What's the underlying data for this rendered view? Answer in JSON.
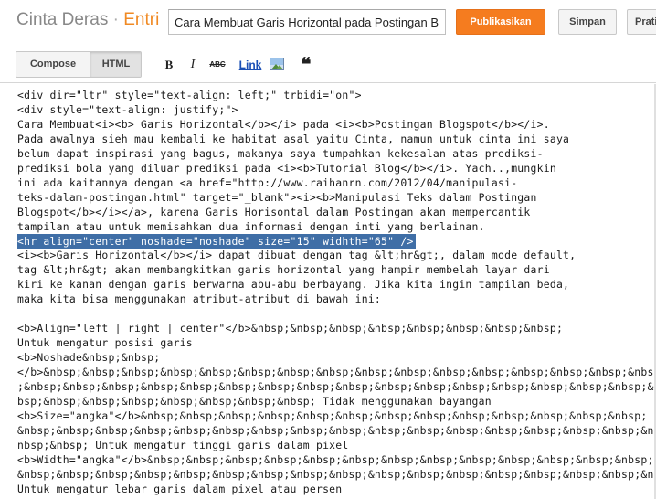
{
  "header": {
    "blog_name": "Cinta Deras",
    "separator": "·",
    "section": "Entri",
    "post_title": "Cara Membuat Garis Horizontal pada Postingan Blogspot",
    "publish_label": "Publikasikan",
    "save_label": "Simpan",
    "preview_label": "Pratinjau"
  },
  "toolbar": {
    "compose_label": "Compose",
    "html_label": "HTML",
    "bold_label": "B",
    "italic_label": "I",
    "strike_label": "ABC",
    "link_label": "Link",
    "image_icon": "insert-image-icon",
    "quote_label": "❝"
  },
  "colors": {
    "accent": "#f08a24",
    "publish_bg": "#f57c1f",
    "selection": "#3f6ea6",
    "link": "#1a4fb5"
  },
  "editor": {
    "lines": [
      "<div dir=\"ltr\" style=\"text-align: left;\" trbidi=\"on\">",
      "<div style=\"text-align: justify;\">",
      "Cara Membuat<i><b> Garis Horizontal</b></i> pada <i><b>Postingan Blogspot</b></i>.",
      "Pada awalnya sieh mau kembali ke habitat asal yaitu Cinta, namun untuk cinta ini saya",
      "belum dapat inspirasi yang bagus, makanya saya tumpahkan kekesalan atas prediksi-",
      "prediksi bola yang diluar prediksi pada <i><b>Tutorial Blog</b></i>. Yach..,mungkin",
      "ini ada kaitannya dengan <a href=\"http://www.raihanrn.com/2012/04/manipulasi-",
      "teks-dalam-postingan.html\" target=\"_blank\"><i><b>Manipulasi Teks dalam Postingan",
      "Blogspot</b></i></a>, karena Garis Horisontal dalam Postingan akan mempercantik",
      "tampilan atau untuk memisahkan dua informasi dengan inti yang berlainan.",
      "<hr align=\"center\" noshade=\"noshade\" size=\"15\" widhth=\"65\" />",
      "<i><b>Garis Horizontal</b></i> dapat dibuat dengan tag &lt;hr&gt;, dalam mode default,",
      "tag &lt;hr&gt; akan membangkitkan garis horizontal yang hampir membelah layar dari",
      "kiri ke kanan dengan garis berwarna abu-abu berbayang. Jika kita ingin tampilan beda,",
      "maka kita bisa menggunakan atribut-atribut di bawah ini:",
      "",
      "<b>Align=\"left | right | center\"</b>&nbsp;&nbsp;&nbsp;&nbsp;&nbsp;&nbsp;&nbsp;&nbsp;",
      "Untuk mengatur posisi garis",
      "<b>Noshade&nbsp;&nbsp;",
      "</b>&nbsp;&nbsp;&nbsp;&nbsp;&nbsp;&nbsp;&nbsp;&nbsp;&nbsp;&nbsp;&nbsp;&nbsp;&nbsp;&nbsp;&nbsp;&nbsp;&nbsp",
      ";&nbsp;&nbsp;&nbsp;&nbsp;&nbsp;&nbsp;&nbsp;&nbsp;&nbsp;&nbsp;&nbsp;&nbsp;&nbsp;&nbsp;&nbsp;&nbsp;&nbsp;&n",
      "bsp;&nbsp;&nbsp;&nbsp;&nbsp;&nbsp;&nbsp;&nbsp; Tidak menggunakan bayangan",
      "<b>Size=\"angka\"</b>&nbsp;&nbsp;&nbsp;&nbsp;&nbsp;&nbsp;&nbsp;&nbsp;&nbsp;&nbsp;&nbsp;&nbsp;&nbsp;",
      "&nbsp;&nbsp;&nbsp;&nbsp;&nbsp;&nbsp;&nbsp;&nbsp;&nbsp;&nbsp;&nbsp;&nbsp;&nbsp;&nbsp;&nbsp;&nbsp;&nbsp;&",
      "nbsp;&nbsp; Untuk mengatur tinggi garis dalam pixel",
      "<b>Width=\"angka\"</b>&nbsp;&nbsp;&nbsp;&nbsp;&nbsp;&nbsp;&nbsp;&nbsp;&nbsp;&nbsp;&nbsp;&nbsp;&nbsp;",
      "&nbsp;&nbsp;&nbsp;&nbsp;&nbsp;&nbsp;&nbsp;&nbsp;&nbsp;&nbsp;&nbsp;&nbsp;&nbsp;&nbsp;&nbsp;&nbsp;&nbsp;&nbsp;",
      "Untuk mengatur lebar garis dalam pixel atau persen"
    ]
  }
}
